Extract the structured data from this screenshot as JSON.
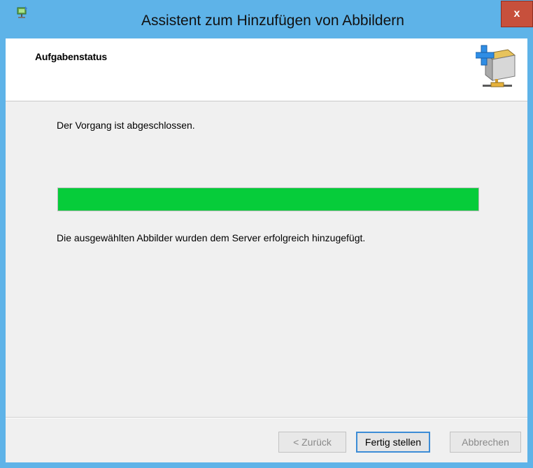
{
  "window": {
    "title": "Assistent zum Hinzufügen von Abbildern",
    "close_label": "x"
  },
  "header": {
    "title": "Aufgabenstatus",
    "icon": "add-image-server-icon"
  },
  "content": {
    "status_text": "Der Vorgang ist abgeschlossen.",
    "progress_fraction": 1.0,
    "progress_color": "#06cc3a",
    "result_text": "Die ausgewählten Abbilder wurden dem Server erfolgreich hinzugefügt."
  },
  "buttons": {
    "back_label": "< Zurück",
    "finish_label": "Fertig stellen",
    "cancel_label": "Abbrechen"
  },
  "colors": {
    "frame": "#5eb3e8",
    "close": "#c7503c",
    "focus_border": "#3c8cd6"
  }
}
